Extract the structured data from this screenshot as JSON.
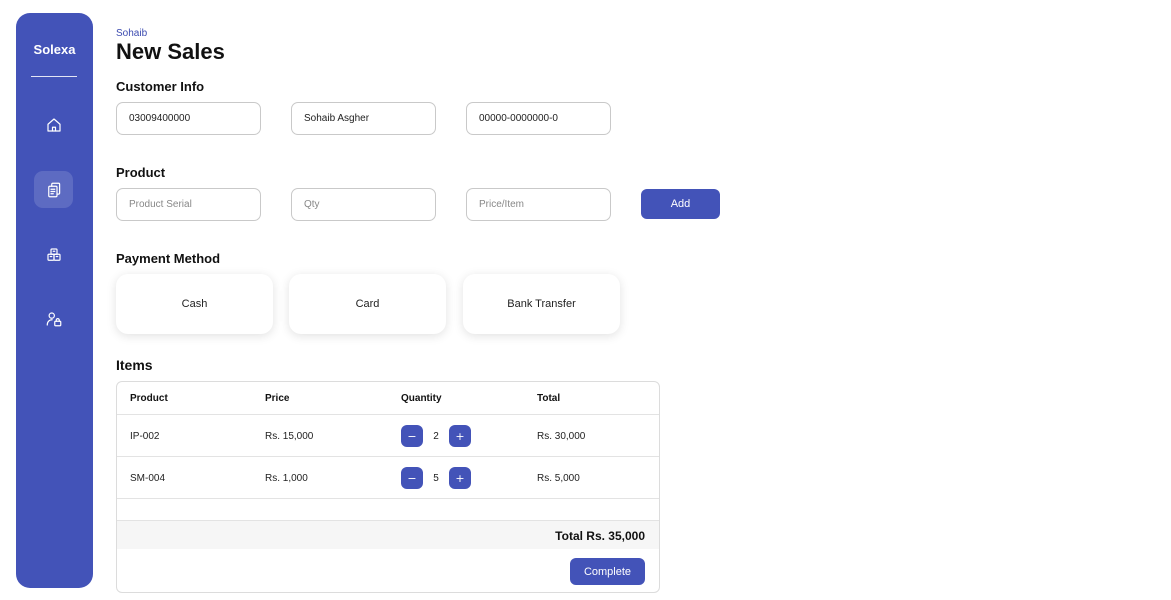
{
  "sidebar": {
    "brand": "Solexa",
    "items": [
      {
        "icon": "home-icon",
        "active": false
      },
      {
        "icon": "documents-icon",
        "active": true
      },
      {
        "icon": "inventory-icon",
        "active": false
      },
      {
        "icon": "user-lock-icon",
        "active": false
      }
    ]
  },
  "header": {
    "user_name": "Sohaib",
    "page_title": "New Sales"
  },
  "customer_info": {
    "label": "Customer Info",
    "phone": "03009400000",
    "name": "Sohaib Asgher",
    "cnic": "00000-0000000-0"
  },
  "product": {
    "label": "Product",
    "serial_placeholder": "Product Serial",
    "qty_placeholder": "Qty",
    "price_placeholder": "Price/Item",
    "add_label": "Add"
  },
  "payment": {
    "label": "Payment Method",
    "options": [
      "Cash",
      "Card",
      "Bank Transfer"
    ]
  },
  "items": {
    "label": "Items",
    "columns": [
      "Product",
      "Price",
      "Quantity",
      "Total"
    ],
    "rows": [
      {
        "product": "IP-002",
        "price": "Rs. 15,000",
        "quantity": "2",
        "total": "Rs. 30,000"
      },
      {
        "product": "SM-004",
        "price": "Rs. 1,000",
        "quantity": "5",
        "total": "Rs. 5,000"
      }
    ],
    "decrement_label": "−",
    "increment_label": "+",
    "grand_total": "Total Rs. 35,000",
    "complete_label": "Complete"
  },
  "colors": {
    "accent": "#4353b8"
  }
}
